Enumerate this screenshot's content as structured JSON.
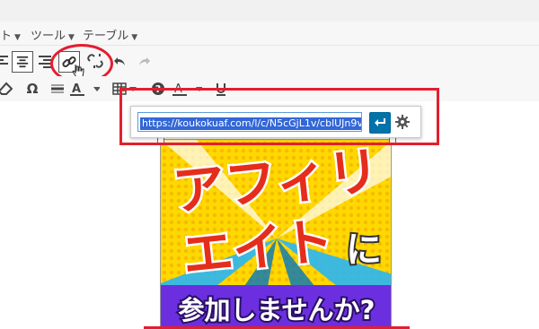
{
  "menubar": {
    "items": [
      {
        "label": "ト"
      },
      {
        "label": "ツール"
      },
      {
        "label": "テーブル"
      }
    ]
  },
  "toolbar": {
    "row1": [
      "align-left-icon",
      "align-center-icon",
      "align-right-icon",
      "insert-link-icon",
      "unlink-icon",
      "undo-icon",
      "redo-icon"
    ],
    "row2": [
      "eraser-icon",
      "special-character-icon",
      "horizontal-line-icon",
      "text-color-icon",
      "table-icon",
      "help-icon",
      "background-color-icon",
      "underline-icon"
    ],
    "special_char_label": "Ω"
  },
  "link_dialog": {
    "url_value": "https://koukokuaf.com/l/c/N5cGjL1v/cblUJn9v",
    "apply_icon": "enter-arrow-icon",
    "options_icon": "gear-icon"
  },
  "banner": {
    "line1": "アフィリ",
    "line2": "エイト",
    "particle": "に",
    "line3": "参加しませんか?"
  },
  "colors": {
    "annotation_red": "#e31e2f",
    "apply_blue": "#0073aa",
    "selection_blue": "#3367d6",
    "banner_yellow": "#ffd800",
    "banner_red": "#d3181e",
    "banner_purple": "#6b2fe0"
  }
}
